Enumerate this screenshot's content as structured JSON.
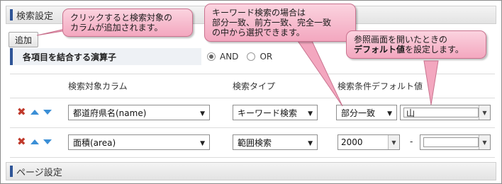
{
  "search_settings": {
    "title": "検索設定"
  },
  "toolbar": {
    "add_label": "追加"
  },
  "operator": {
    "label": "各項目を結合する演算子",
    "options": [
      "AND",
      "OR"
    ],
    "selected": "AND"
  },
  "table": {
    "headers": [
      "検索対象カラム",
      "検索タイプ",
      "検索条件デフォルト値"
    ],
    "rows": [
      {
        "column": "都道府県名(name)",
        "search_type": "キーワード検索",
        "match_type": "部分一致",
        "default_value": "山"
      },
      {
        "column": "面積(area)",
        "search_type": "範囲検索",
        "range_from": "2000",
        "range_separator": "-",
        "range_to": ""
      }
    ]
  },
  "page_settings": {
    "title": "ページ設定"
  },
  "callouts": {
    "add_column": {
      "line1": "クリックすると検索対象の",
      "line2": "カラムが追加されます。"
    },
    "keyword": {
      "line1": "キーワード検索の場合は",
      "line2": "部分一致、前方一致、完全一致",
      "line3": "の中から選択できます。"
    },
    "default": {
      "line1": "参照画面を開いたときの",
      "bold": "デフォルト値",
      "rest": "を設定します。"
    }
  },
  "colors": {
    "callout_fill": "#f7bccf",
    "header_accent": "#2f5597",
    "delete_icon": "#c0392b",
    "arrow_icon": "#3b8fd6"
  }
}
